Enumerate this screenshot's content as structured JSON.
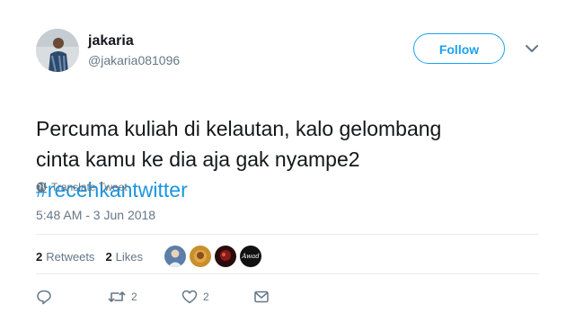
{
  "author": {
    "name": "jakaria",
    "handle": "@jakaria081096"
  },
  "follow_label": "Follow",
  "tweet": {
    "text": "Percuma kuliah di kelautan,  kalo gelombang\ncinta kamu ke dia aja gak nyampe2",
    "hashtag": "#recehkantwitter"
  },
  "translate_label": "Translate Tweet",
  "timestamp": "5:48 AM - 3 Jun 2018",
  "stats": {
    "retweets_count": "2",
    "retweets_label": "Retweets",
    "likes_count": "2",
    "likes_label": "Likes"
  },
  "likers": [
    {
      "icon": "avatar-1"
    },
    {
      "icon": "avatar-2"
    },
    {
      "icon": "avatar-3"
    },
    {
      "icon": "avatar-4",
      "text": "Awad"
    }
  ],
  "actions": {
    "reply_count": "",
    "retweet_count": "2",
    "like_count": "2"
  },
  "colors": {
    "accent": "#1da1f2",
    "hashtag": "#1b95e0",
    "muted": "#657786"
  }
}
